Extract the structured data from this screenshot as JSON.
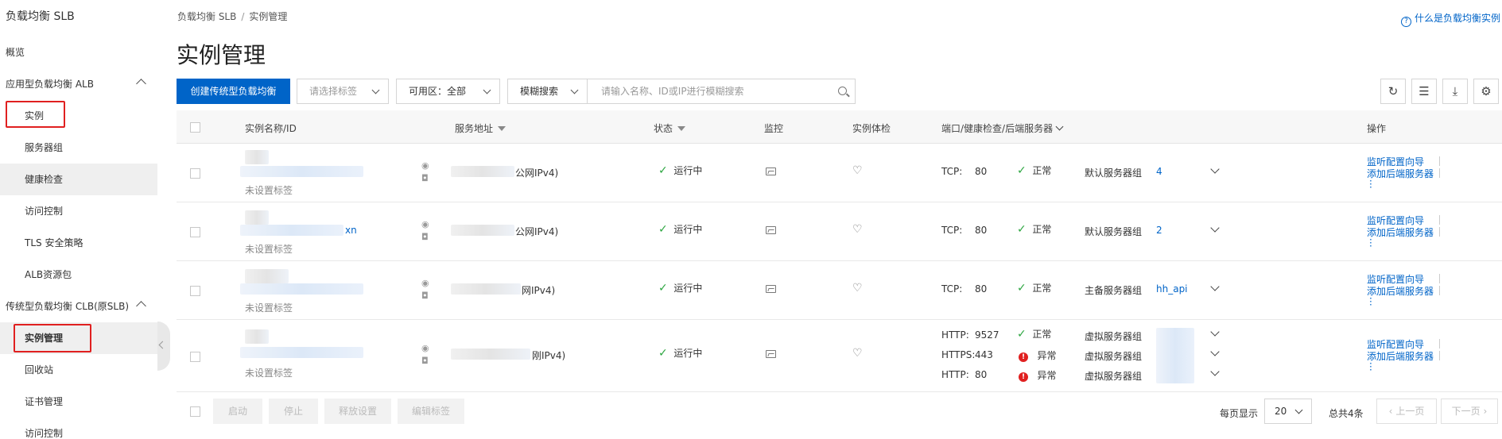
{
  "sidebar": {
    "title": "负载均衡 SLB",
    "items": [
      {
        "label": "概览"
      },
      {
        "label": "应用型负载均衡 ALB"
      },
      {
        "label": "实例"
      },
      {
        "label": "服务器组"
      },
      {
        "label": "健康检查"
      },
      {
        "label": "访问控制"
      },
      {
        "label": "TLS 安全策略"
      },
      {
        "label": "ALB资源包"
      },
      {
        "label": "传统型负载均衡 CLB(原SLB)"
      },
      {
        "label": "实例管理"
      },
      {
        "label": "回收站"
      },
      {
        "label": "证书管理"
      },
      {
        "label": "访问控制"
      }
    ]
  },
  "breadcrumb": {
    "root": "负载均衡 SLB",
    "sep": "/",
    "current": "实例管理"
  },
  "help_link": "什么是负载均衡实例",
  "page_title": "实例管理",
  "toolbar": {
    "create_button": "创建传统型负载均衡",
    "tag_select_placeholder": "请选择标签",
    "zone_select": "可用区：全部",
    "search_mode": "模糊搜索",
    "search_placeholder": "请输入名称、ID或IP进行模糊搜索"
  },
  "table": {
    "headers": [
      "实例名称/ID",
      "服务地址",
      "状态",
      "监控",
      "实例体检",
      "端口/健康检查/后端服务器",
      "操作"
    ],
    "rows": [
      {
        "tag": "未设置标签",
        "id_suffix": "",
        "addr_suffix": "公网IPv4)",
        "status": "运行中",
        "ports": [
          {
            "proto": "TCP:",
            "port": "80",
            "health": "正常",
            "health_ok": true,
            "group": "默认服务器组",
            "group_link": "4"
          }
        ]
      },
      {
        "tag": "未设置标签",
        "id_suffix": "xn",
        "addr_suffix": "公网IPv4)",
        "status": "运行中",
        "ports": [
          {
            "proto": "TCP:",
            "port": "80",
            "health": "正常",
            "health_ok": true,
            "group": "默认服务器组",
            "group_link": "2"
          }
        ]
      },
      {
        "tag": "未设置标签",
        "id_suffix": "",
        "addr_suffix": "网IPv4)",
        "status": "运行中",
        "ports": [
          {
            "proto": "TCP:",
            "port": "80",
            "health": "正常",
            "health_ok": true,
            "group": "主备服务器组",
            "group_link": "hh_api"
          }
        ]
      },
      {
        "tag": "未设置标签",
        "id_suffix": "",
        "addr_suffix": "刚IPv4)",
        "status": "运行中",
        "ports": [
          {
            "proto": "HTTP:",
            "port": "9527",
            "health": "正常",
            "health_ok": true,
            "group": "虚拟服务器组",
            "group_link": ""
          },
          {
            "proto": "HTTPS:",
            "port": "443",
            "health": "异常",
            "health_ok": false,
            "group": "虚拟服务器组",
            "group_link": ""
          },
          {
            "proto": "HTTP:",
            "port": "80",
            "health": "异常",
            "health_ok": false,
            "group": "虚拟服务器组",
            "group_link": ""
          }
        ]
      }
    ],
    "actions": {
      "listen": "监听配置向导",
      "add_backend": "添加后端服务器"
    }
  },
  "footer": {
    "buttons": [
      "启动",
      "停止",
      "释放设置",
      "编辑标签"
    ],
    "page_size_label": "每页显示",
    "page_size": "20",
    "total": "总共4条",
    "prev": "上一页",
    "next": "下一页"
  }
}
